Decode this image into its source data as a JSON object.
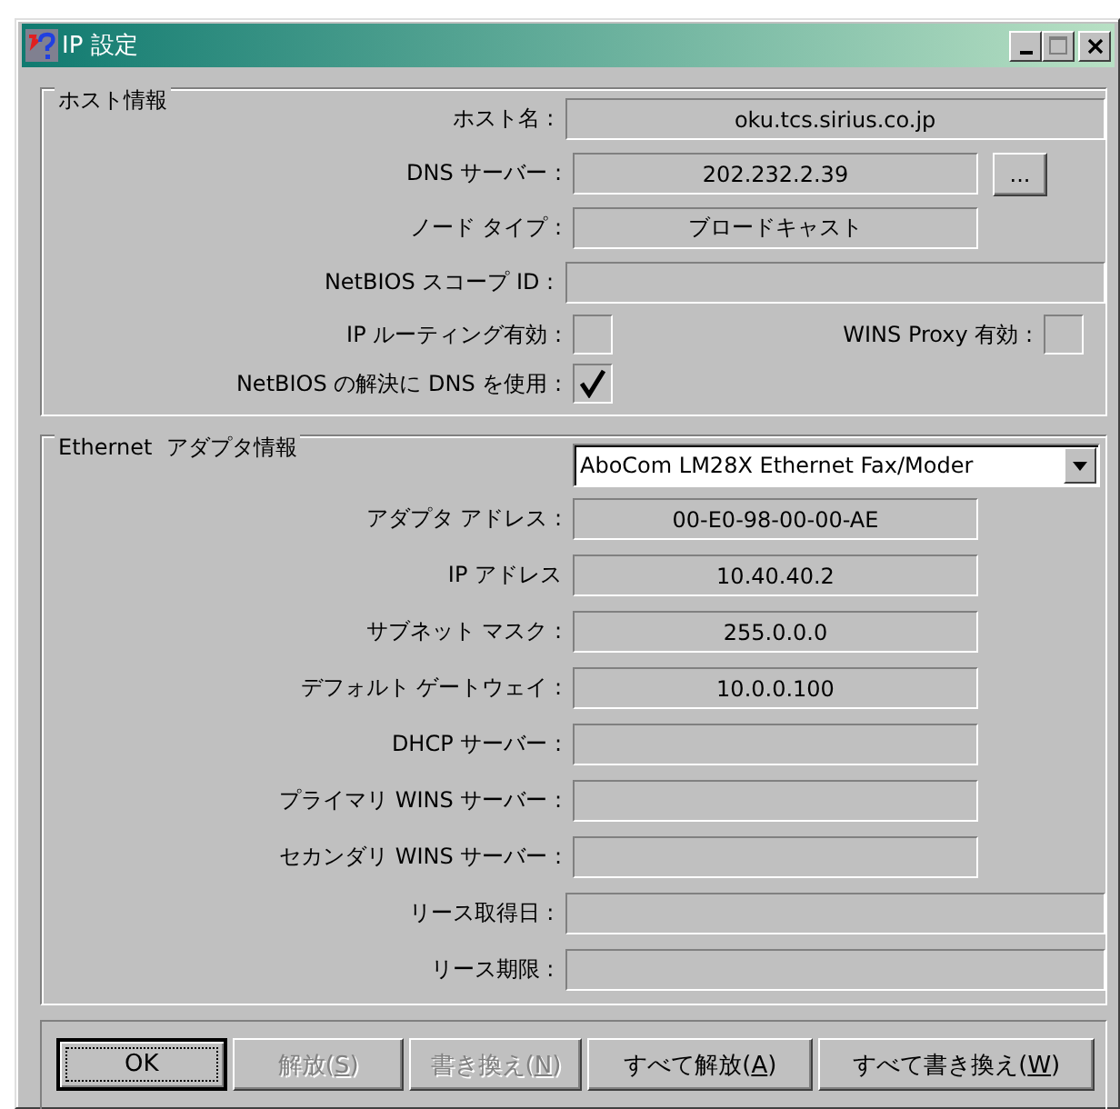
{
  "window": {
    "title": "IP 設定"
  },
  "host_info": {
    "title": "ホスト情報",
    "rows": [
      {
        "kind": "wide",
        "label": "ホスト名 :",
        "value": "oku.tcs.sirius.co.jp"
      },
      {
        "kind": "narrow",
        "label": "DNS サーバー :",
        "value": "202.232.2.39",
        "button": "..."
      },
      {
        "kind": "narrow",
        "label": "ノード タイプ :",
        "value": "ブロードキャスト"
      },
      {
        "kind": "wide",
        "label": "NetBIOS スコープ ID :"
      },
      {
        "kind": "checkbox_pair",
        "label": "IP ルーティング有効 :",
        "checked": false,
        "label_2": "WINS Proxy 有効 :",
        "checked_2": false
      },
      {
        "kind": "checkbox",
        "label": "NetBIOS の解決に DNS を使用 :",
        "checked": true
      }
    ]
  },
  "adapter_info": {
    "title": "Ethernet  アダプタ情報",
    "adapter": "AboCom LM28X Ethernet Fax/Moder",
    "rows": [
      {
        "kind": "narrow",
        "label": "アダプタ アドレス :",
        "value": "00-E0-98-00-00-AE"
      },
      {
        "kind": "narrow",
        "label": "IP アドレス",
        "value": "10.40.40.2"
      },
      {
        "kind": "narrow",
        "label": "サブネット マスク :",
        "value": "255.0.0.0"
      },
      {
        "kind": "narrow",
        "label": "デフォルト ゲートウェイ :",
        "value": "10.0.0.100"
      },
      {
        "kind": "narrow",
        "label": "DHCP サーバー :"
      },
      {
        "kind": "narrow",
        "label": "プライマリ WINS サーバー :"
      },
      {
        "kind": "narrow",
        "label": "セカンダリ WINS サーバー :"
      },
      {
        "kind": "wide",
        "label": "リース取得日 :"
      },
      {
        "kind": "wide",
        "label": "リース期限 :"
      }
    ]
  },
  "buttons": [
    {
      "text": "OK",
      "disabled": false,
      "default": true
    },
    {
      "text": "解放(",
      "mnemonic": "S",
      "suffix": ")",
      "disabled": true,
      "default": false
    },
    {
      "text": "書き換え(",
      "mnemonic": "N",
      "suffix": ")",
      "disabled": true,
      "default": false
    },
    {
      "text": "すべて解放(",
      "mnemonic": "A",
      "suffix": ")",
      "disabled": false,
      "default": false
    },
    {
      "text": "すべて書き換え(",
      "mnemonic": "W",
      "suffix": ")",
      "disabled": false,
      "default": false
    }
  ]
}
